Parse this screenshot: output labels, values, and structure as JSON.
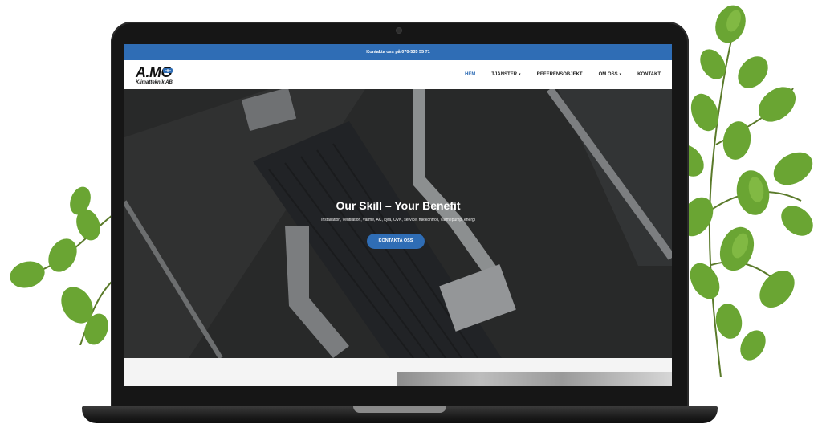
{
  "topbar": {
    "contact_text": "Kontakta oss på 070-535 55 71"
  },
  "logo": {
    "mark": "A.MO",
    "subtitle": "Klimatteknik AB"
  },
  "nav": {
    "items": [
      {
        "label": "HEM",
        "active": true,
        "has_dropdown": false
      },
      {
        "label": "TJÄNSTER",
        "active": false,
        "has_dropdown": true
      },
      {
        "label": "REFERENSOBJEKT",
        "active": false,
        "has_dropdown": false
      },
      {
        "label": "OM OSS",
        "active": false,
        "has_dropdown": true
      },
      {
        "label": "KONTAKT",
        "active": false,
        "has_dropdown": false
      }
    ]
  },
  "hero": {
    "title": "Our Skill – Your Benefit",
    "subtitle": "Installation, ventilation, värme, AC, kyla, OVK, service, fuktkontroll, värmepump, energi",
    "button_label": "KONTAKTA OSS"
  },
  "colors": {
    "accent": "#2f6db5",
    "hero_bg": "#303131",
    "laptop_frame": "#161616"
  }
}
